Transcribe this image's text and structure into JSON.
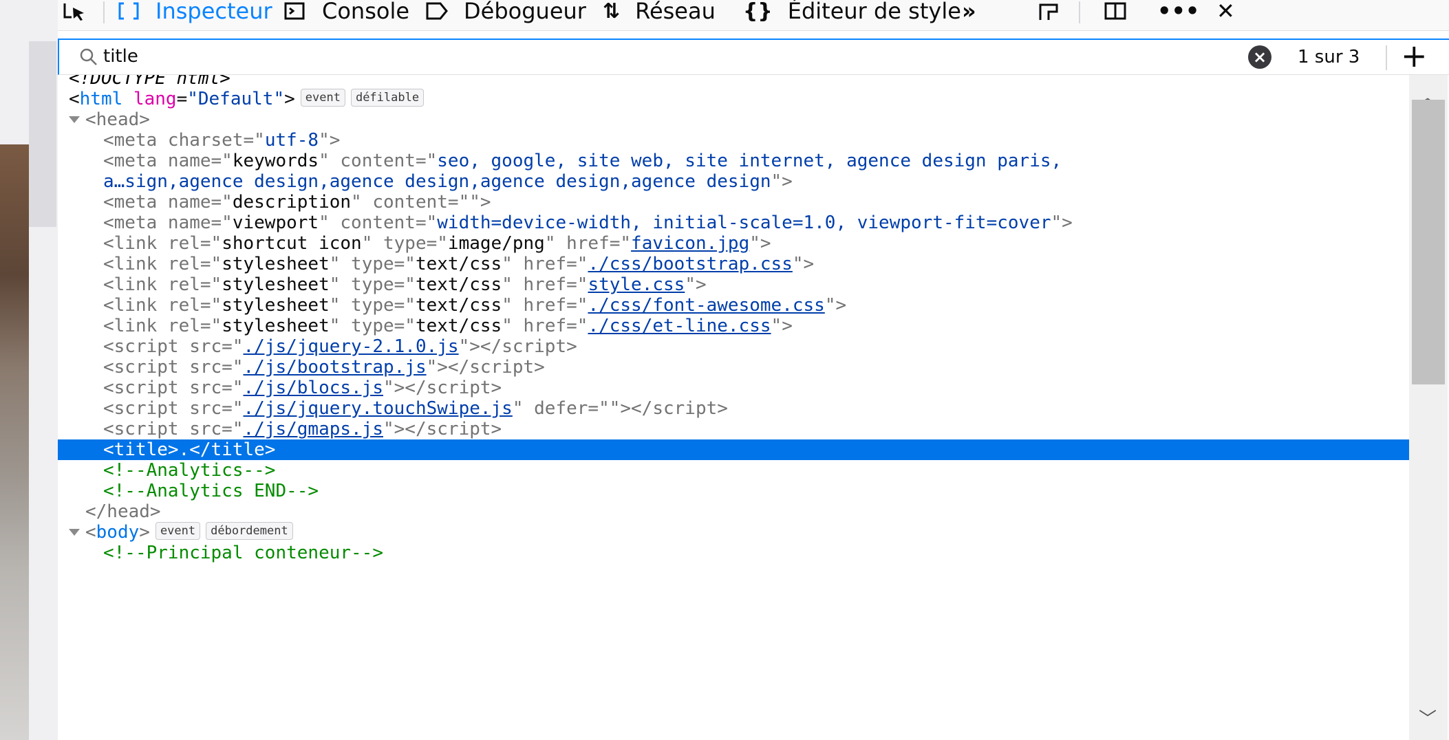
{
  "toolbar": {
    "tabs": [
      {
        "label": "Inspecteur",
        "icon": "inspector-icon",
        "active": true
      },
      {
        "label": "Console",
        "icon": "console-icon",
        "active": false
      },
      {
        "label": "Débogueur",
        "icon": "debugger-icon",
        "active": false
      },
      {
        "label": "Réseau",
        "icon": "network-icon",
        "active": false
      },
      {
        "label": "Éditeur de style",
        "icon": "style-editor-icon",
        "active": false
      }
    ],
    "more_glyph": "»",
    "right_icons": [
      "dock-icon",
      "split-panel-icon",
      "more-options-icon",
      "close-icon"
    ]
  },
  "search": {
    "value": "title",
    "match_count": "1 sur 3"
  },
  "markup": {
    "doctype": "<!DOCTYPE html>",
    "html_tag": "html",
    "html_lang": "Default",
    "badge_event": "event",
    "badge_scrollable": "défilable",
    "badge_overflow": "débordement",
    "head_tag": "head",
    "body_tag": "body",
    "meta_charset": "utf-8",
    "meta_keywords": "seo, google, site web, site internet, agence design paris,",
    "meta_keywords_cont": "a…sign,agence design,agence design,agence design,agence design",
    "meta_description": "",
    "meta_viewport": "width=device-width, initial-scale=1.0, viewport-fit=cover",
    "link_icon_href": "favicon.jpg",
    "css1": "./css/bootstrap.css",
    "css2": "style.css",
    "css3": "./css/font-awesome.css",
    "css4": "./css/et-line.css",
    "js1": "./js/jquery-2.1.0.js",
    "js2": "./js/bootstrap.js",
    "js3": "./js/blocs.js",
    "js4": "./js/jquery.touchSwipe.js",
    "js5": "./js/gmaps.js",
    "title_line": "<title>.</title>",
    "comment1": "<!--Analytics-->",
    "comment2": "<!--Analytics END-->",
    "comment3": "<!--Principal conteneur-->"
  },
  "colors": {
    "accent": "#0a84ff",
    "selection": "#0074e8",
    "attribute": "#dd00a9",
    "value": "#003eaa",
    "comment": "#058b00"
  }
}
